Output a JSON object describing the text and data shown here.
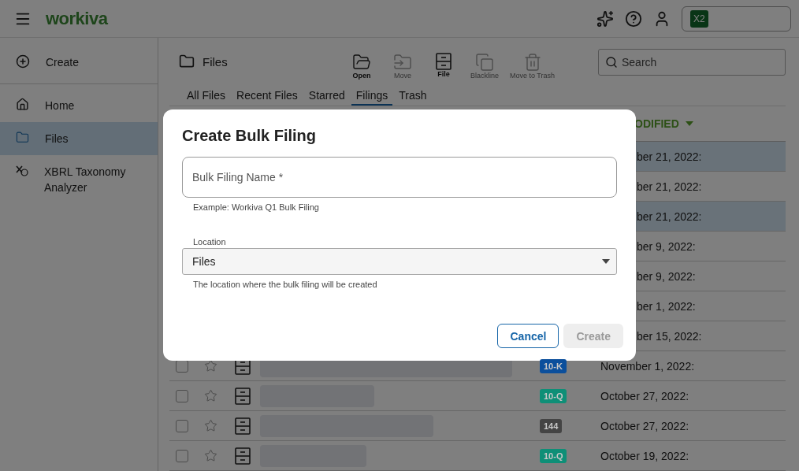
{
  "topbar": {
    "logo": "workiva",
    "account_badge": "X2"
  },
  "sidebar": {
    "items": [
      {
        "label": "Create",
        "kind": "create",
        "selected": false
      },
      {
        "label": "Home",
        "kind": "home",
        "selected": false
      },
      {
        "label": "Files",
        "kind": "files",
        "selected": true
      },
      {
        "label": "XBRL Taxonomy Analyzer",
        "kind": "xbrl",
        "selected": false
      }
    ]
  },
  "location": {
    "title": "Files"
  },
  "toolbar": [
    {
      "label": "Open",
      "kind": "open",
      "disabled": false
    },
    {
      "label": "Move",
      "kind": "move",
      "disabled": true
    },
    {
      "label": "File",
      "kind": "file",
      "disabled": false
    },
    {
      "label": "Blackline",
      "kind": "blackline",
      "disabled": true
    },
    {
      "label": "Move to Trash",
      "kind": "trash",
      "disabled": true
    }
  ],
  "search": {
    "placeholder": "Search"
  },
  "tabs": [
    {
      "label": "All Files",
      "selected": false
    },
    {
      "label": "Recent Files",
      "selected": false
    },
    {
      "label": "Starred",
      "selected": false
    },
    {
      "label": "Filings",
      "selected": true
    },
    {
      "label": "Trash",
      "selected": false
    }
  ],
  "table": {
    "sort_header": "ODIFIED",
    "rows": [
      {
        "kind": "covered",
        "selected": true,
        "date": "ber 21, 2022:"
      },
      {
        "kind": "covered",
        "selected": false,
        "date": "ber 21, 2022:"
      },
      {
        "kind": "covered",
        "selected": true,
        "date": "ber 21, 2022:"
      },
      {
        "kind": "covered",
        "selected": false,
        "date": "ber 9, 2022:"
      },
      {
        "kind": "covered",
        "selected": false,
        "date": "ber 9, 2022:"
      },
      {
        "kind": "covered",
        "selected": false,
        "date": "ber 1, 2022:"
      },
      {
        "kind": "covered",
        "selected": false,
        "date": "ber 15, 2022:"
      },
      {
        "kind": "full",
        "selected": false,
        "checked": false,
        "starred": false,
        "badge": {
          "label": "10-K",
          "color": "#0b4f9c"
        },
        "date": "November 1, 2022:"
      },
      {
        "kind": "full",
        "selected": false,
        "checked": false,
        "starred": false,
        "badge": {
          "label": "10-Q",
          "color": "#0e8f77"
        },
        "date": "October 27, 2022:"
      },
      {
        "kind": "full",
        "selected": false,
        "checked": false,
        "starred": false,
        "badge": {
          "label": "144",
          "color": "#444444"
        },
        "date": "October 27, 2022:"
      },
      {
        "kind": "full",
        "selected": false,
        "checked": false,
        "starred": false,
        "badge": {
          "label": "10-Q",
          "color": "#0e8f77"
        },
        "date": "October 19, 2022:"
      }
    ]
  },
  "dialog": {
    "title": "Create Bulk Filing",
    "name_field": {
      "placeholder": "Bulk Filing Name *",
      "helper": "Example: Workiva Q1 Bulk Filing"
    },
    "location_field": {
      "label": "Location",
      "value": "Files",
      "helper": "The location where the bulk filing will be created"
    },
    "buttons": [
      {
        "label": "Cancel",
        "kind": "secondary",
        "disabled": false
      },
      {
        "label": "Create",
        "kind": "primary",
        "disabled": true
      }
    ]
  }
}
